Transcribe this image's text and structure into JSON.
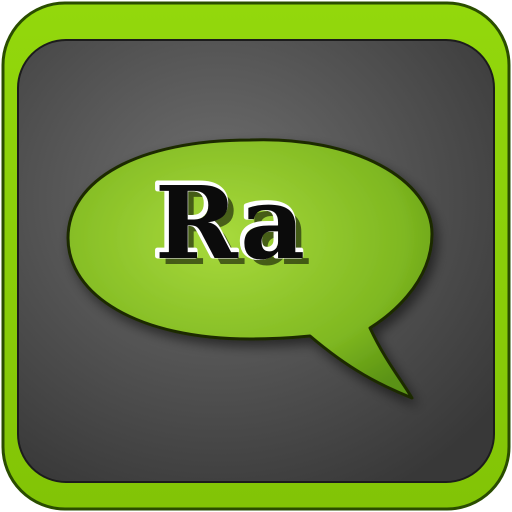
{
  "app_icon": {
    "label": "Ra",
    "colors": {
      "frame_green": "#8dd10a",
      "frame_outline": "#2a4d00",
      "panel_light": "#6b6b6b",
      "panel_dark": "#3a3a3a",
      "bubble_light": "#a6d83a",
      "bubble_dark": "#5f9c12",
      "bubble_outline": "#1e2b05",
      "text_fill": "#0b0b0b",
      "text_highlight": "#ffffff"
    },
    "icons": [
      "speech-bubble-icon"
    ]
  }
}
